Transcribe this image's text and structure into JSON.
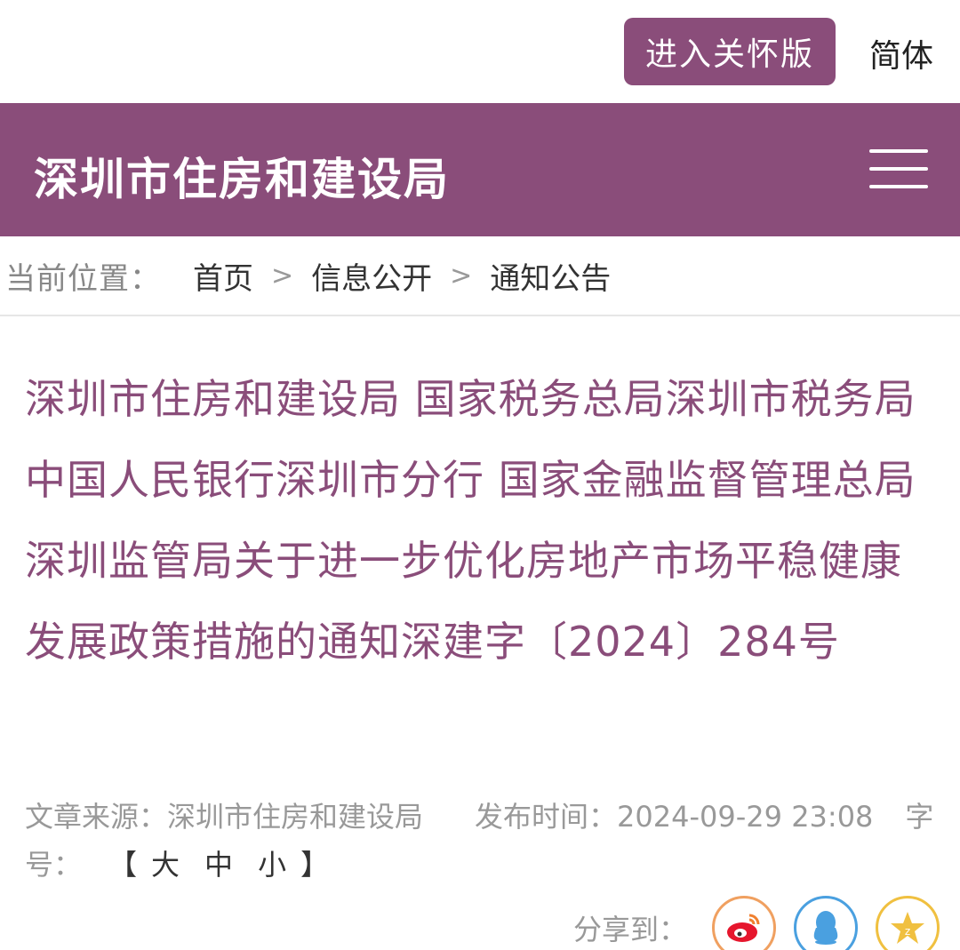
{
  "topbar": {
    "care_button_label": "进入关怀版",
    "language_label": "简体"
  },
  "header": {
    "site_title": "深圳市住房和建设局"
  },
  "breadcrumb": {
    "prefix": "当前位置：",
    "items": [
      "首页",
      "信息公开",
      "通知公告"
    ],
    "separator": ">"
  },
  "article": {
    "title": "深圳市住房和建设局 国家税务总局深圳市税务局 中国人民银行深圳市分行 国家金融监督管理总局深圳监管局关于进一步优化房地产市场平稳健康发展政策措施的通知深建字〔2024〕284号",
    "source_label": "文章来源：",
    "source_value": "深圳市住房和建设局",
    "publish_label": "发布时间：",
    "publish_value": "2024-09-29 23:08",
    "font_size_label": "字号：",
    "font_size_open": "【",
    "font_size_large": "大",
    "font_size_medium": "中",
    "font_size_small": "小",
    "font_size_close": "】"
  },
  "share": {
    "label": "分享到：",
    "icons": [
      "weibo-icon",
      "qq-icon",
      "qzone-icon"
    ]
  },
  "colors": {
    "brand": "#8a4d7a",
    "weibo": "#e6162d",
    "qq": "#4aa0e0",
    "qzone": "#f0c040"
  }
}
